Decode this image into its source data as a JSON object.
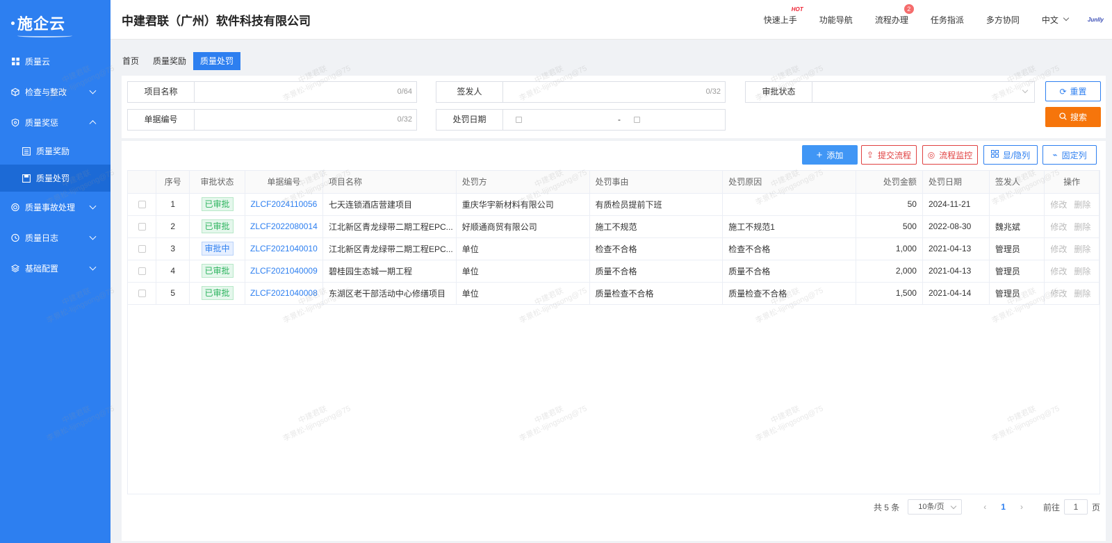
{
  "sidebar": {
    "logo": "施企云",
    "menu": [
      {
        "label": "质量云",
        "icon": "grid-icon",
        "expanded": null
      },
      {
        "label": "检查与整改",
        "icon": "cube-icon",
        "expanded": false
      },
      {
        "label": "质量奖惩",
        "icon": "shield-icon",
        "expanded": true
      },
      {
        "label": "质量事故处理",
        "icon": "target-icon",
        "expanded": false
      },
      {
        "label": "质量日志",
        "icon": "calendar-icon",
        "expanded": false
      },
      {
        "label": "基础配置",
        "icon": "layers-icon",
        "expanded": false
      }
    ],
    "submenu": [
      {
        "label": "质量奖励",
        "icon": "list-icon",
        "active": false
      },
      {
        "label": "质量处罚",
        "icon": "save-icon",
        "active": true
      }
    ]
  },
  "header": {
    "company": "中建君联（广州）软件科技有限公司",
    "nav": {
      "quick_start": "快速上手",
      "hot": "HOT",
      "feature_nav": "功能导航",
      "process": "流程办理",
      "process_badge": "2",
      "task": "任务指派",
      "collab": "多方协同",
      "language": "中文",
      "brand_mini": "Junlly"
    }
  },
  "tabs": [
    {
      "label": "首页",
      "active": false
    },
    {
      "label": "质量奖励",
      "active": false
    },
    {
      "label": "质量处罚",
      "active": true
    }
  ],
  "search": {
    "project_name": {
      "label": "项目名称",
      "value": "",
      "count": "0/64"
    },
    "issuer": {
      "label": "签发人",
      "value": "",
      "count": "0/32"
    },
    "approval_status": {
      "label": "审批状态",
      "value": ""
    },
    "doc_no": {
      "label": "单据编号",
      "value": "",
      "count": "0/32"
    },
    "penalty_date": {
      "label": "处罚日期",
      "separator": "-"
    },
    "reset_label": "重置",
    "search_label": "搜索"
  },
  "toolbar": {
    "add": "添加",
    "submit_flow": "提交流程",
    "flow_monitor": "流程监控",
    "show_hide_cols": "显/隐列",
    "fixed_cols": "固定列"
  },
  "table": {
    "columns": [
      "序号",
      "审批状态",
      "单据编号",
      "项目名称",
      "处罚方",
      "处罚事由",
      "处罚原因",
      "处罚金额",
      "处罚日期",
      "签发人",
      "操作"
    ],
    "rows": [
      {
        "no": "1",
        "status": "已审批",
        "status_type": "done",
        "doc_no": "ZLCF2024110056",
        "project": "七天连锁酒店营建项目",
        "party": "重庆华宇新材料有限公司",
        "reason": "有质检员提前下班",
        "cause": "",
        "amount": "50",
        "date": "2024-11-21",
        "issuer": ""
      },
      {
        "no": "2",
        "status": "已审批",
        "status_type": "done",
        "doc_no": "ZLCF2022080014",
        "project": "江北新区青龙绿带二期工程EPC...",
        "party": "好顺通商贸有限公司",
        "reason": "施工不规范",
        "cause": "施工不规范1",
        "amount": "500",
        "date": "2022-08-30",
        "issuer": "魏兆斌"
      },
      {
        "no": "3",
        "status": "审批中",
        "status_type": "doing",
        "doc_no": "ZLCF2021040010",
        "project": "江北新区青龙绿带二期工程EPC...",
        "party": "单位",
        "reason": "检查不合格",
        "cause": "检查不合格",
        "amount": "1,000",
        "date": "2021-04-13",
        "issuer": "管理员"
      },
      {
        "no": "4",
        "status": "已审批",
        "status_type": "done",
        "doc_no": "ZLCF2021040009",
        "project": "碧桂园生态城一期工程",
        "party": "单位",
        "reason": "质量不合格",
        "cause": "质量不合格",
        "amount": "2,000",
        "date": "2021-04-13",
        "issuer": "管理员"
      },
      {
        "no": "5",
        "status": "已审批",
        "status_type": "done",
        "doc_no": "ZLCF2021040008",
        "project": "东湖区老干部活动中心修缮项目",
        "party": "单位",
        "reason": "质量检查不合格",
        "cause": "质量检查不合格",
        "amount": "1,500",
        "date": "2021-04-14",
        "issuer": "管理员"
      }
    ],
    "op_edit": "修改",
    "op_delete": "删除"
  },
  "pager": {
    "total": "共 5 条",
    "page_size": "10条/页",
    "current": "1",
    "goto_label": "前往",
    "goto_value": "1",
    "page_suffix": "页",
    "prev": "‹",
    "next": "›"
  },
  "watermark": {
    "line1": "中建君联",
    "line2": "李景松-lijingsong@75"
  },
  "colors": {
    "primary": "#2d7ff0",
    "search": "#f6750b",
    "danger": "#e04141",
    "success": "#2bb35d"
  }
}
